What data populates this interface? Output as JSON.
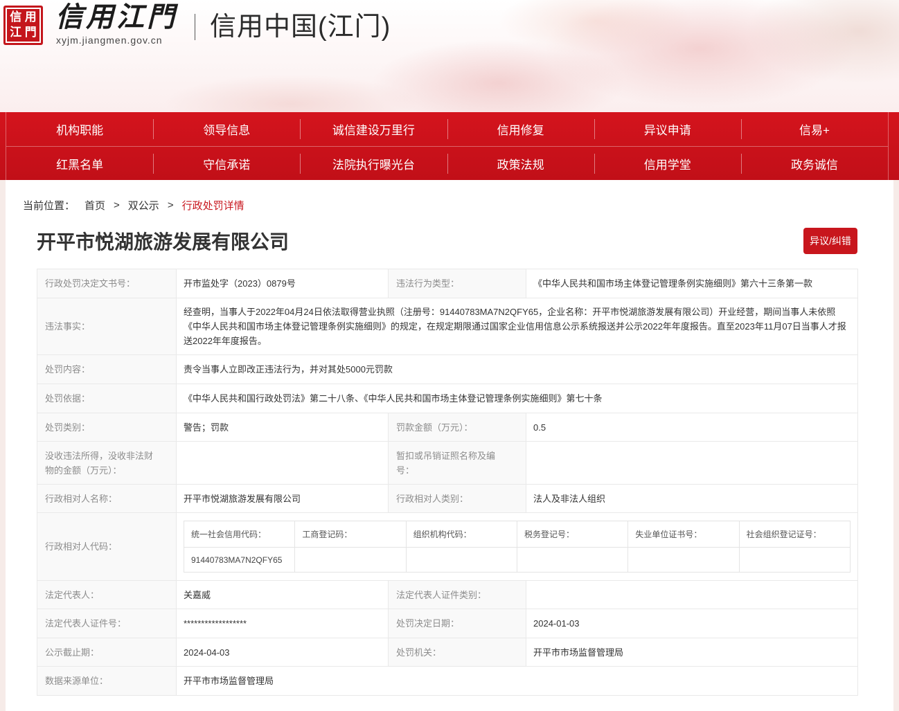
{
  "theme": {
    "primary": "#c8161d",
    "nav_background": "#c9121b"
  },
  "header": {
    "logo_seal": [
      "信",
      "用",
      "江",
      "門"
    ],
    "brand_name": "信用江門",
    "domain": "xyjm.jiangmen.gov.cn",
    "site_title": "信用中国(江门)"
  },
  "nav": {
    "row1": [
      "机构职能",
      "领导信息",
      "诚信建设万里行",
      "信用修复",
      "异议申请",
      "信易+"
    ],
    "row2": [
      "红黑名单",
      "守信承诺",
      "法院执行曝光台",
      "政策法规",
      "信用学堂",
      "政务诚信"
    ]
  },
  "breadcrumb": {
    "prefix": "当前位置：",
    "separator": ">",
    "items": [
      "首页",
      "双公示",
      "行政处罚详情"
    ]
  },
  "page": {
    "company_name": "开平市悦湖旅游发展有限公司",
    "objection_button": "异议/纠错"
  },
  "details": {
    "doc_number": {
      "label": "行政处罚决定文书号：",
      "value": "开市监处字（2023）0879号"
    },
    "violation_type": {
      "label": "违法行为类型：",
      "value": "《中华人民共和国市场主体登记管理条例实施细则》第六十三条第一款"
    },
    "violation_facts": {
      "label": "违法事实：",
      "value": "经查明，当事人于2022年04月24日依法取得营业执照（注册号：91440783MA7N2QFY65，企业名称：开平市悦湖旅游发展有限公司）开业经营，期间当事人未依照《中华人民共和国市场主体登记管理条例实施细则》的规定，在规定期限通过国家企业信用信息公示系统报送并公示2022年年度报告。直至2023年11月07日当事人才报送2022年年度报告。"
    },
    "penalty_content": {
      "label": "处罚内容：",
      "value": "责令当事人立即改正违法行为，并对其处5000元罚款"
    },
    "penalty_basis": {
      "label": "处罚依据：",
      "value": "《中华人民共和国行政处罚法》第二十八条、《中华人民共和国市场主体登记管理条例实施细则》第七十条"
    },
    "penalty_category": {
      "label": "处罚类别：",
      "value": "警告；罚款"
    },
    "fine_amount": {
      "label": "罚款金额（万元）：",
      "value": "0.5"
    },
    "confiscation_amount": {
      "label": "没收违法所得，没收非法财物的金额（万元）：",
      "value": ""
    },
    "license_revocation": {
      "label": "暂扣或吊销证照名称及编号：",
      "value": ""
    },
    "counterpart_name": {
      "label": "行政相对人名称：",
      "value": "开平市悦湖旅游发展有限公司"
    },
    "counterpart_category": {
      "label": "行政相对人类别：",
      "value": "法人及非法人组织"
    },
    "counterpart_code": {
      "label": "行政相对人代码：",
      "headers": [
        "统一社会信用代码：",
        "工商登记码：",
        "组织机构代码：",
        "税务登记号：",
        "失业单位证书号：",
        "社会组织登记证号："
      ],
      "values": [
        "91440783MA7N2QFY65",
        "",
        "",
        "",
        "",
        ""
      ]
    },
    "legal_rep": {
      "label": "法定代表人：",
      "value": "关嘉威"
    },
    "legal_rep_id_type": {
      "label": "法定代表人证件类别：",
      "value": ""
    },
    "legal_rep_id_number": {
      "label": "法定代表人证件号：",
      "value": "******************"
    },
    "decision_date": {
      "label": "处罚决定日期：",
      "value": "2024-01-03"
    },
    "publicity_deadline": {
      "label": "公示截止期：",
      "value": "2024-04-03"
    },
    "penalty_authority": {
      "label": "处罚机关：",
      "value": "开平市市场监督管理局"
    },
    "data_source": {
      "label": "数据来源单位：",
      "value": "开平市市场监督管理局"
    }
  }
}
